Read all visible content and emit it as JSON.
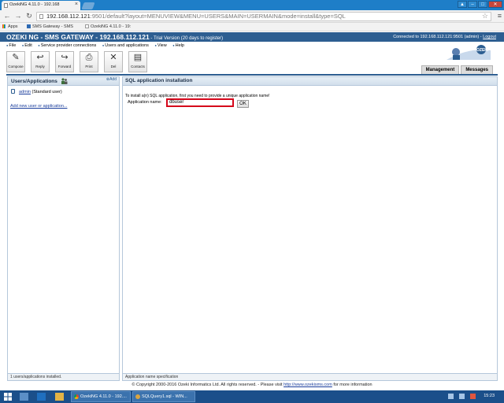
{
  "browser": {
    "tab_title": "OzekiNG 4.11.0 - 192.168",
    "url_host": "192.168.112.121",
    "url_rest": ":9501/default?layout=MENUVIEW&MENU=USERS&MAIN=USERMAIN&mode=install&type=SQL",
    "bookmarks": [
      "Apps",
      "SMS Gateway - SMS",
      "OzekiNG 4.11.0 - 19:"
    ]
  },
  "app": {
    "title": "OZEKI NG - SMS GATEWAY - 192.168.112.121",
    "trial": " - Trial Version (20 days to register)",
    "connected": "Connected to 192.168.112.121:9501 (admin) -",
    "logout": "Logout",
    "menu": [
      "File",
      "Edit",
      "Service provider connections",
      "Users and applications",
      "View",
      "Help"
    ],
    "toolbar": {
      "compose": "Compose",
      "reply": "Reply",
      "forward": "Forward",
      "print": "Print",
      "del": "Del",
      "contacts": "Contacts"
    },
    "logo_text": "OZEKI",
    "tabs": {
      "management": "Management",
      "messages": "Messages"
    }
  },
  "left_panel": {
    "title": "Users/Applications",
    "add_label": "Add",
    "user_link": "admin",
    "user_type": "(Standard user)",
    "add_new_link": "Add new user or application...",
    "status": "1 users/applications installed."
  },
  "main_panel": {
    "title": "SQL application installation",
    "intro": "To install a(n) SQL application, first you need to provide a unique application name!",
    "field_label": "Application name:",
    "field_value": "dbuser",
    "ok_label": "OK",
    "status": "Application name specification"
  },
  "footer": {
    "copyright": "© Copyright 2000-2016 Ozeki Informatics Ltd. All rights reserved. - Please visit",
    "link": "http://www.ozekisms.com",
    "suffix": "for more information"
  },
  "taskbar": {
    "items": [
      "OzekiNG 4.11.0 - 192....",
      "SQLQuery1.sql - WIN..."
    ],
    "clock": "15:23"
  }
}
